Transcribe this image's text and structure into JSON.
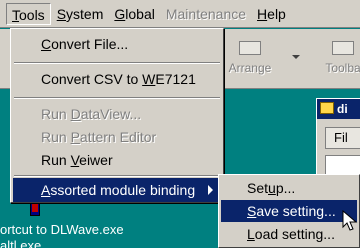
{
  "menubar": {
    "items": [
      {
        "label": "Tools",
        "accel": "T",
        "rest": "ools"
      },
      {
        "label": "System",
        "accel": "S",
        "rest": "ystem"
      },
      {
        "label": "Global",
        "accel": "G",
        "rest": "lobal"
      },
      {
        "label": "Maintenance"
      },
      {
        "label": "Help",
        "accel": "H",
        "rest": "elp"
      }
    ]
  },
  "toolbar": {
    "arrange_label": "Arrange",
    "toolbar_label": "Toolba"
  },
  "tools_menu": {
    "convert_file": {
      "accel": "C",
      "rest": "onvert File..."
    },
    "convert_csv": {
      "pre": "Convert CSV to ",
      "accel": "W",
      "rest": "E7121"
    },
    "run_dataview": {
      "pre": "Run ",
      "accel": "D",
      "rest": "ataView..."
    },
    "run_pattern": {
      "pre": "Run ",
      "accel": "P",
      "rest": "attern Editor"
    },
    "run_viewer": {
      "pre": "Run ",
      "accel": "V",
      "rest": "eiwer"
    },
    "assorted": {
      "accel": "A",
      "rest": "ssorted module binding"
    }
  },
  "submenu": {
    "setup": {
      "pre": "Set",
      "accel": "u",
      "rest": "p..."
    },
    "save": {
      "accel": "S",
      "rest": "ave setting..."
    },
    "load": {
      "accel": "L",
      "rest": "oad setting..."
    }
  },
  "background": {
    "child_title": "di",
    "child_tab": "Fil",
    "shortcut_line1": "ortcut to DLWave.exe",
    "shortcut_line2": "altl exe"
  }
}
